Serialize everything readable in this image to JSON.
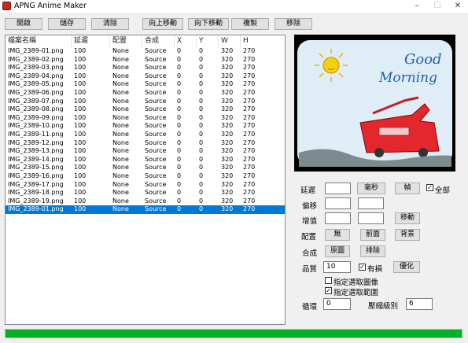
{
  "window": {
    "title": "APNG Anime Maker",
    "minimize_glyph": "–",
    "maximize_glyph": "☐",
    "close_glyph": "✕"
  },
  "toolbar": {
    "open": "開啟",
    "save": "儲存",
    "clear": "清除",
    "move_up": "向上移動",
    "move_down": "向下移動",
    "copy": "複製",
    "delete": "移除"
  },
  "list": {
    "headers": [
      "檔案名稱",
      "延遲",
      "配置",
      "合成",
      "X",
      "Y",
      "W",
      "H"
    ],
    "rows": [
      [
        "IMG_2389-01.png",
        "100",
        "None",
        "Source",
        "0",
        "0",
        "320",
        "270"
      ],
      [
        "IMG_2389-02.png",
        "100",
        "None",
        "Source",
        "0",
        "0",
        "320",
        "270"
      ],
      [
        "IMG_2389-03.png",
        "100",
        "None",
        "Source",
        "0",
        "0",
        "320",
        "270"
      ],
      [
        "IMG_2389-04.png",
        "100",
        "None",
        "Source",
        "0",
        "0",
        "320",
        "270"
      ],
      [
        "IMG_2389-05.png",
        "100",
        "None",
        "Source",
        "0",
        "0",
        "320",
        "270"
      ],
      [
        "IMG_2389-06.png",
        "100",
        "None",
        "Source",
        "0",
        "0",
        "320",
        "270"
      ],
      [
        "IMG_2389-07.png",
        "100",
        "None",
        "Source",
        "0",
        "0",
        "320",
        "270"
      ],
      [
        "IMG_2389-08.png",
        "100",
        "None",
        "Source",
        "0",
        "0",
        "320",
        "270"
      ],
      [
        "IMG_2389-09.png",
        "100",
        "None",
        "Source",
        "0",
        "0",
        "320",
        "270"
      ],
      [
        "IMG_2389-10.png",
        "100",
        "None",
        "Source",
        "0",
        "0",
        "320",
        "270"
      ],
      [
        "IMG_2389-11.png",
        "100",
        "None",
        "Source",
        "0",
        "0",
        "320",
        "270"
      ],
      [
        "IMG_2389-12.png",
        "100",
        "None",
        "Source",
        "0",
        "0",
        "320",
        "270"
      ],
      [
        "IMG_2389-13.png",
        "100",
        "None",
        "Source",
        "0",
        "0",
        "320",
        "270"
      ],
      [
        "IMG_2389-14.png",
        "100",
        "None",
        "Source",
        "0",
        "0",
        "320",
        "270"
      ],
      [
        "IMG_2389-15.png",
        "100",
        "None",
        "Source",
        "0",
        "0",
        "320",
        "270"
      ],
      [
        "IMG_2389-16.png",
        "100",
        "None",
        "Source",
        "0",
        "0",
        "320",
        "270"
      ],
      [
        "IMG_2389-17.png",
        "100",
        "None",
        "Source",
        "0",
        "0",
        "320",
        "270"
      ],
      [
        "IMG_2389-18.png",
        "100",
        "None",
        "Source",
        "0",
        "0",
        "320",
        "270"
      ],
      [
        "IMG_2389-19.png",
        "100",
        "None",
        "Source",
        "0",
        "0",
        "320",
        "270"
      ],
      [
        "IMG_2389-01.png",
        "100",
        "None",
        "Source",
        "0",
        "0",
        "320",
        "270"
      ]
    ],
    "selected_index": 19,
    "selection_color": "#0078d7"
  },
  "preview": {
    "text_line1": "Good",
    "text_line2": "Morning",
    "text_color": "#1f5fb8",
    "sun_color": "#f5d20a",
    "truck_color": "#e3272d",
    "sky_color": "#dfeef6"
  },
  "props": {
    "delay_label": "延遲",
    "delay_value": "",
    "ms_button": "毫秒",
    "frame_button": "幀",
    "all_checkbox_label": "全部",
    "all_checked": true,
    "offset_label": "偏移",
    "offset_x": "",
    "offset_y": "",
    "increment_label": "增值",
    "increment_x": "",
    "increment_y": "",
    "move_button": "移動",
    "dispose_label": "配置",
    "dispose_none": "無",
    "dispose_previous": "前面",
    "dispose_background": "背景",
    "blend_label": "合成",
    "blend_source": "原圖",
    "blend_over": "排除",
    "quality_label": "品質",
    "quality_value": "10",
    "dither_label": "有損",
    "dither_checked": true,
    "optimize_button": "優化",
    "spec_img_label": "指定選取圖像",
    "spec_img_checked": false,
    "spec_range_label": "指定選取範圍",
    "spec_range_checked": true,
    "loop_label": "循環",
    "loop_value": "0",
    "compression_label": "壓縮級別",
    "compression_value": "6"
  },
  "progress": {
    "value": 1.0,
    "color": "#06b025"
  }
}
